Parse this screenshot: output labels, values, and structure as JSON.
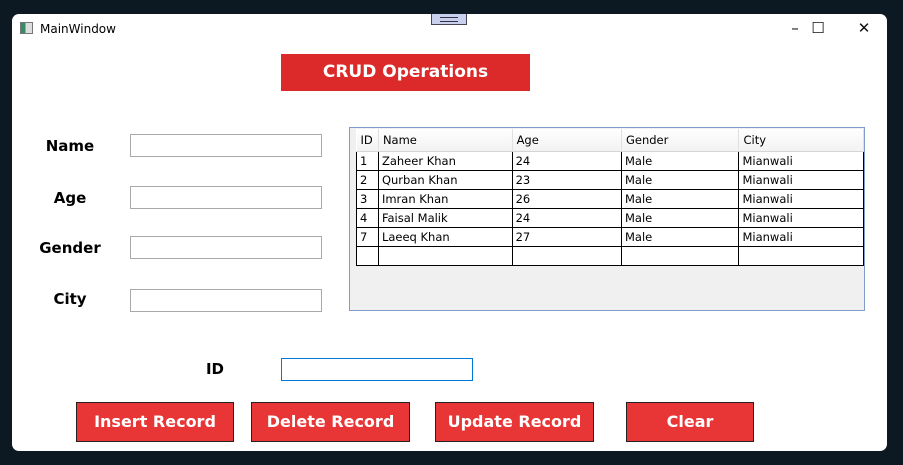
{
  "window": {
    "title": "MainWindow",
    "minimize": "–",
    "maximize": "☐",
    "close": "✕"
  },
  "header": "CRUD Operations",
  "form": {
    "name_label": "Name",
    "age_label": "Age",
    "gender_label": "Gender",
    "city_label": "City",
    "id_label": "ID",
    "name_value": "",
    "age_value": "",
    "gender_value": "",
    "city_value": "",
    "id_value": ""
  },
  "grid": {
    "columns": [
      "ID",
      "Name",
      "Age",
      "Gender",
      "City"
    ],
    "rows": [
      [
        "1",
        "Zaheer Khan",
        "24",
        "Male",
        "Mianwali"
      ],
      [
        "2",
        "Qurban Khan",
        "23",
        "Male",
        "Mianwali"
      ],
      [
        "3",
        "Imran Khan",
        "26",
        "Male",
        "Mianwali"
      ],
      [
        "4",
        "Faisal Malik",
        "24",
        "Male",
        "Mianwali"
      ],
      [
        "7",
        "Laeeq Khan",
        "27",
        "Male",
        "Mianwali"
      ]
    ]
  },
  "buttons": {
    "insert": "Insert Record",
    "delete": "Delete Record",
    "update": "Update Record",
    "clear": "Clear"
  }
}
